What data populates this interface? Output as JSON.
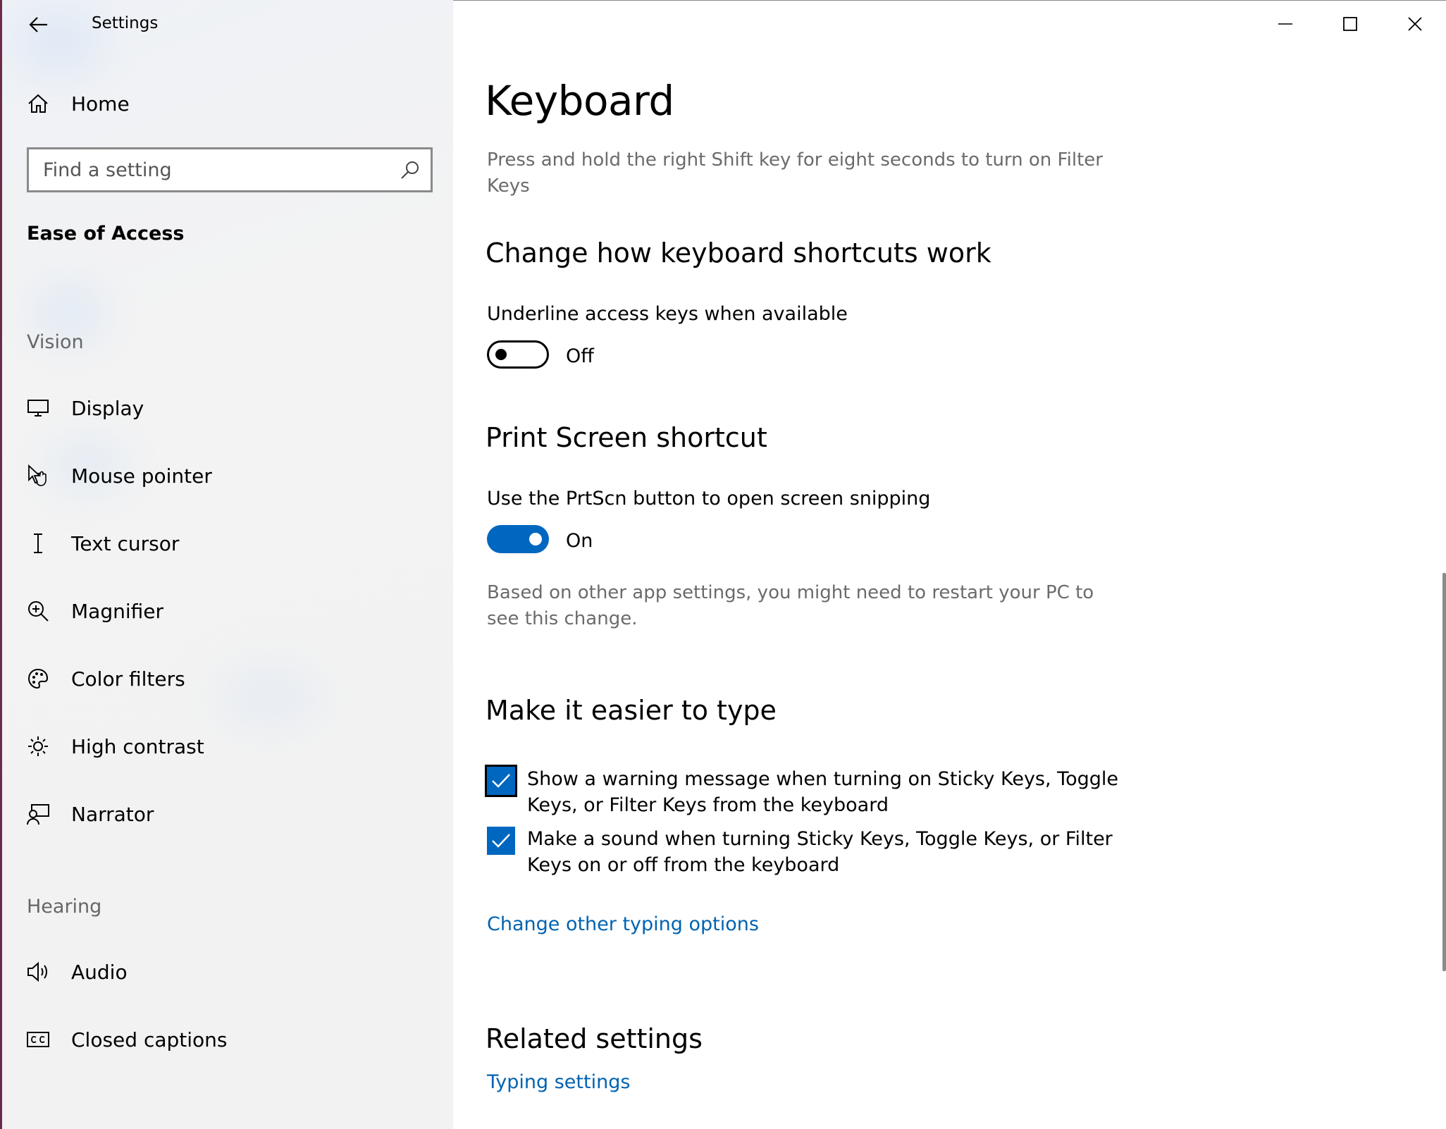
{
  "window": {
    "app_title": "Settings",
    "minimize_icon": "minimize-icon",
    "maximize_icon": "maximize-icon",
    "close_icon": "close-icon"
  },
  "sidebar": {
    "home_label": "Home",
    "search_placeholder": "Find a setting",
    "section_title": "Ease of Access",
    "vision_label": "Vision",
    "vision_items": [
      {
        "label": "Display",
        "icon": "monitor-icon"
      },
      {
        "label": "Mouse pointer",
        "icon": "mouse-pointer-icon"
      },
      {
        "label": "Text cursor",
        "icon": "text-cursor-icon"
      },
      {
        "label": "Magnifier",
        "icon": "magnifier-icon"
      },
      {
        "label": "Color filters",
        "icon": "palette-icon"
      },
      {
        "label": "High contrast",
        "icon": "sun-icon"
      },
      {
        "label": "Narrator",
        "icon": "narrator-icon"
      }
    ],
    "hearing_label": "Hearing",
    "hearing_items": [
      {
        "label": "Audio",
        "icon": "speaker-icon"
      },
      {
        "label": "Closed captions",
        "icon": "cc-icon"
      }
    ]
  },
  "main": {
    "page_title": "Keyboard",
    "filter_keys_desc": "Press and hold the right Shift key for eight seconds to turn on Filter Keys",
    "shortcuts": {
      "heading": "Change how keyboard shortcuts work",
      "underline_label": "Underline access keys when available",
      "underline_state": "Off"
    },
    "print_screen": {
      "heading": "Print Screen shortcut",
      "prtscn_label": "Use the PrtScn button to open screen snipping",
      "prtscn_state": "On",
      "restart_note": "Based on other app settings, you might need to restart your PC to see this change."
    },
    "typing": {
      "heading": "Make it easier to type",
      "warning_checkbox": "Show a warning message when turning on Sticky Keys, Toggle Keys, or Filter Keys from the keyboard",
      "sound_checkbox": "Make a sound when turning Sticky Keys, Toggle Keys, or Filter Keys on or off from the keyboard",
      "other_options_link": "Change other typing options"
    },
    "related": {
      "heading": "Related settings",
      "typing_settings_link": "Typing settings"
    }
  },
  "colors": {
    "accent": "#0067c0",
    "link": "#0063b1",
    "secondary_text": "#6b6b6b"
  }
}
